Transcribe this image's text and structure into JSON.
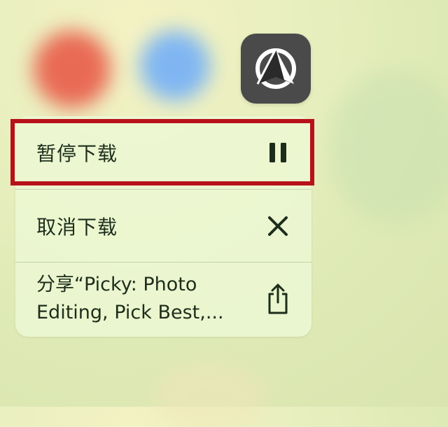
{
  "app_icon": {
    "name": "app-logo"
  },
  "menu": {
    "items": [
      {
        "label": "暂停下载",
        "icon": "pause-icon"
      },
      {
        "label": "取消下载",
        "icon": "close-icon"
      },
      {
        "label_line1": "分享“Picky: Photo",
        "label_line2": "Editing, Pick Best,...",
        "icon": "share-icon"
      }
    ]
  },
  "colors": {
    "highlight": "#b8111a",
    "app_icon_bg": "#4a4a4a",
    "text": "#1d2d1b"
  }
}
